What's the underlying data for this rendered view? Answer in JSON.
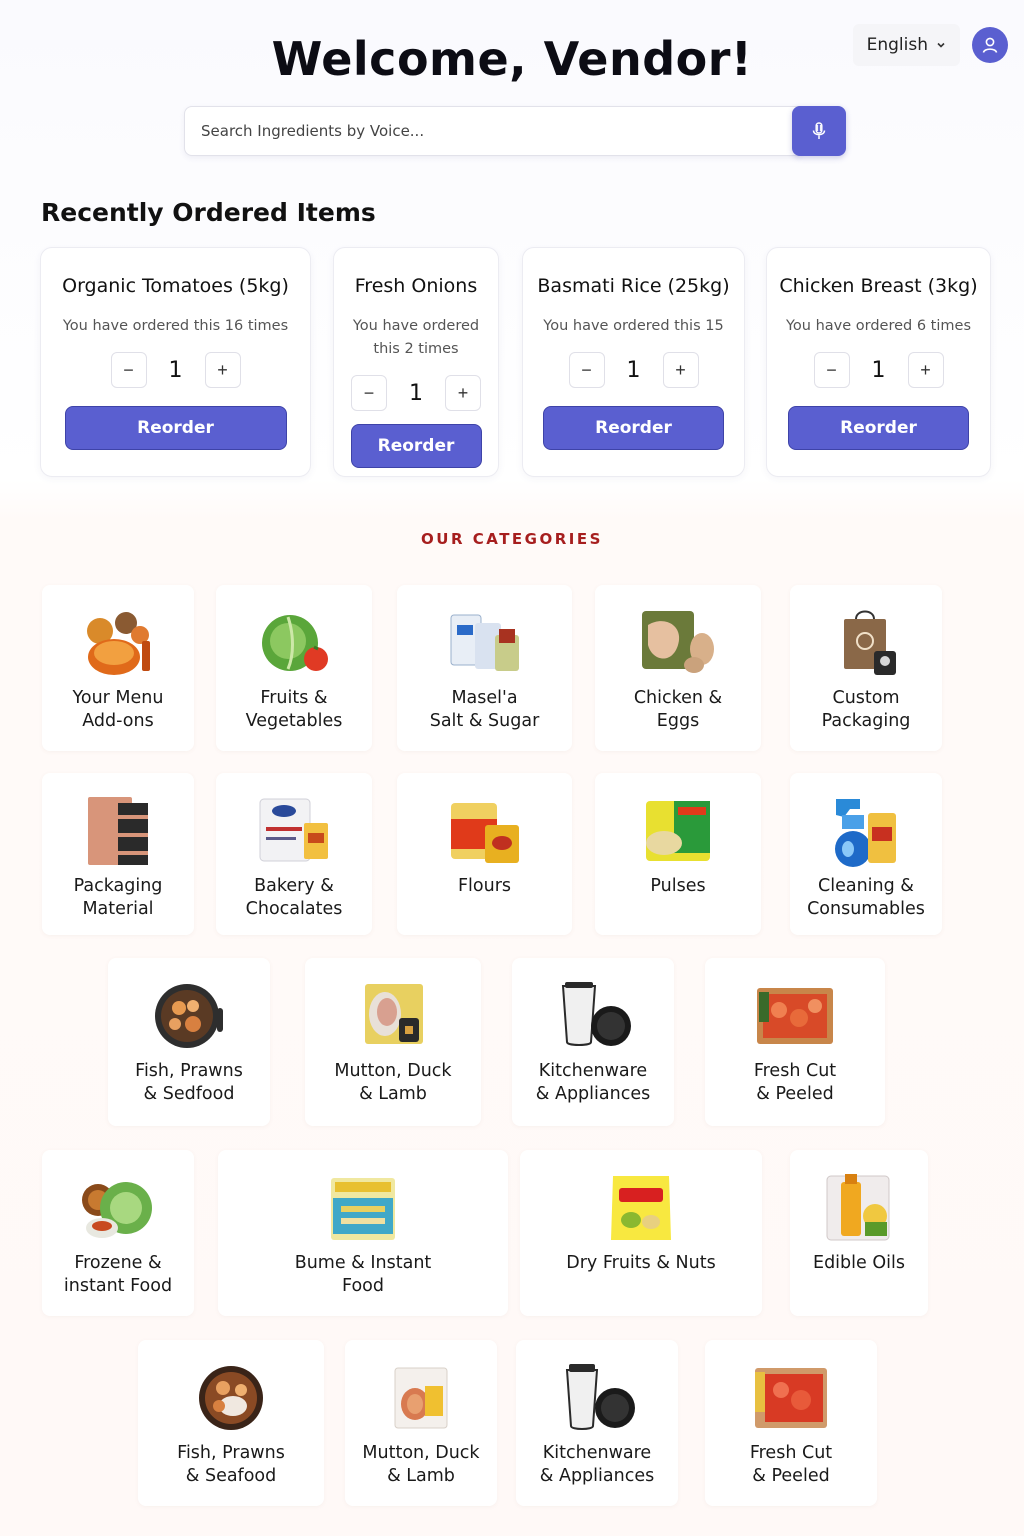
{
  "header": {
    "title": "Welcome, Vendor!",
    "language": "English",
    "language_icon": "chevron-down-icon",
    "avatar_icon": "user-icon"
  },
  "search": {
    "placeholder": "Search Ingredients by Voice...",
    "mic_icon": "microphone-icon"
  },
  "recent": {
    "title": "Recently Ordered Items",
    "reorder_label": "Reorder",
    "items": [
      {
        "name": "Organic Tomatoes (5kg)",
        "count_text": "You have ordered this 16 times",
        "qty": "1"
      },
      {
        "name": "Fresh Onions",
        "count_text": "You have ordered this 2 times",
        "qty": "1"
      },
      {
        "name": "Basmati Rice (25kg)",
        "count_text": "You have ordered this 15",
        "qty": "1"
      },
      {
        "name": "Chicken Breast (3kg)",
        "count_text": "You have ordered 6 times",
        "qty": "1"
      }
    ]
  },
  "categories": {
    "title": "OUR CATEGORIES",
    "items": [
      {
        "label": "Your Menu\nAdd-ons"
      },
      {
        "label": "Fruits &\nVegetables"
      },
      {
        "label": "Masel'a\nSalt & Sugar"
      },
      {
        "label": "Chicken &\nEggs"
      },
      {
        "label": "Custom\nPackaging"
      },
      {
        "label": "Packaging\nMaterial"
      },
      {
        "label": "Bakery &\nChocalates"
      },
      {
        "label": "Flours"
      },
      {
        "label": "Pulses"
      },
      {
        "label": "Cleaning &\nConsumables"
      },
      {
        "label": "Fish, Prawns\n& Sedfood"
      },
      {
        "label": "Mutton, Duck\n& Lamb"
      },
      {
        "label": "Kitchenware\n& Appliances"
      },
      {
        "label": "Fresh Cut\n& Peeled"
      },
      {
        "label": "Frozene &\ninstant Food"
      },
      {
        "label": "Bume & Instant\nFood"
      },
      {
        "label": "Dry Fruits & Nuts"
      },
      {
        "label": "Edible Oils"
      },
      {
        "label": "Fish, Prawns\n& Seafood"
      },
      {
        "label": "Mutton, Duck\n& Lamb"
      },
      {
        "label": "Kitchenware\n& Appliances"
      },
      {
        "label": "Fresh Cut\n& Peeled"
      }
    ]
  },
  "colors": {
    "accent": "#5a5fd0",
    "category_title": "#a61e1e"
  }
}
